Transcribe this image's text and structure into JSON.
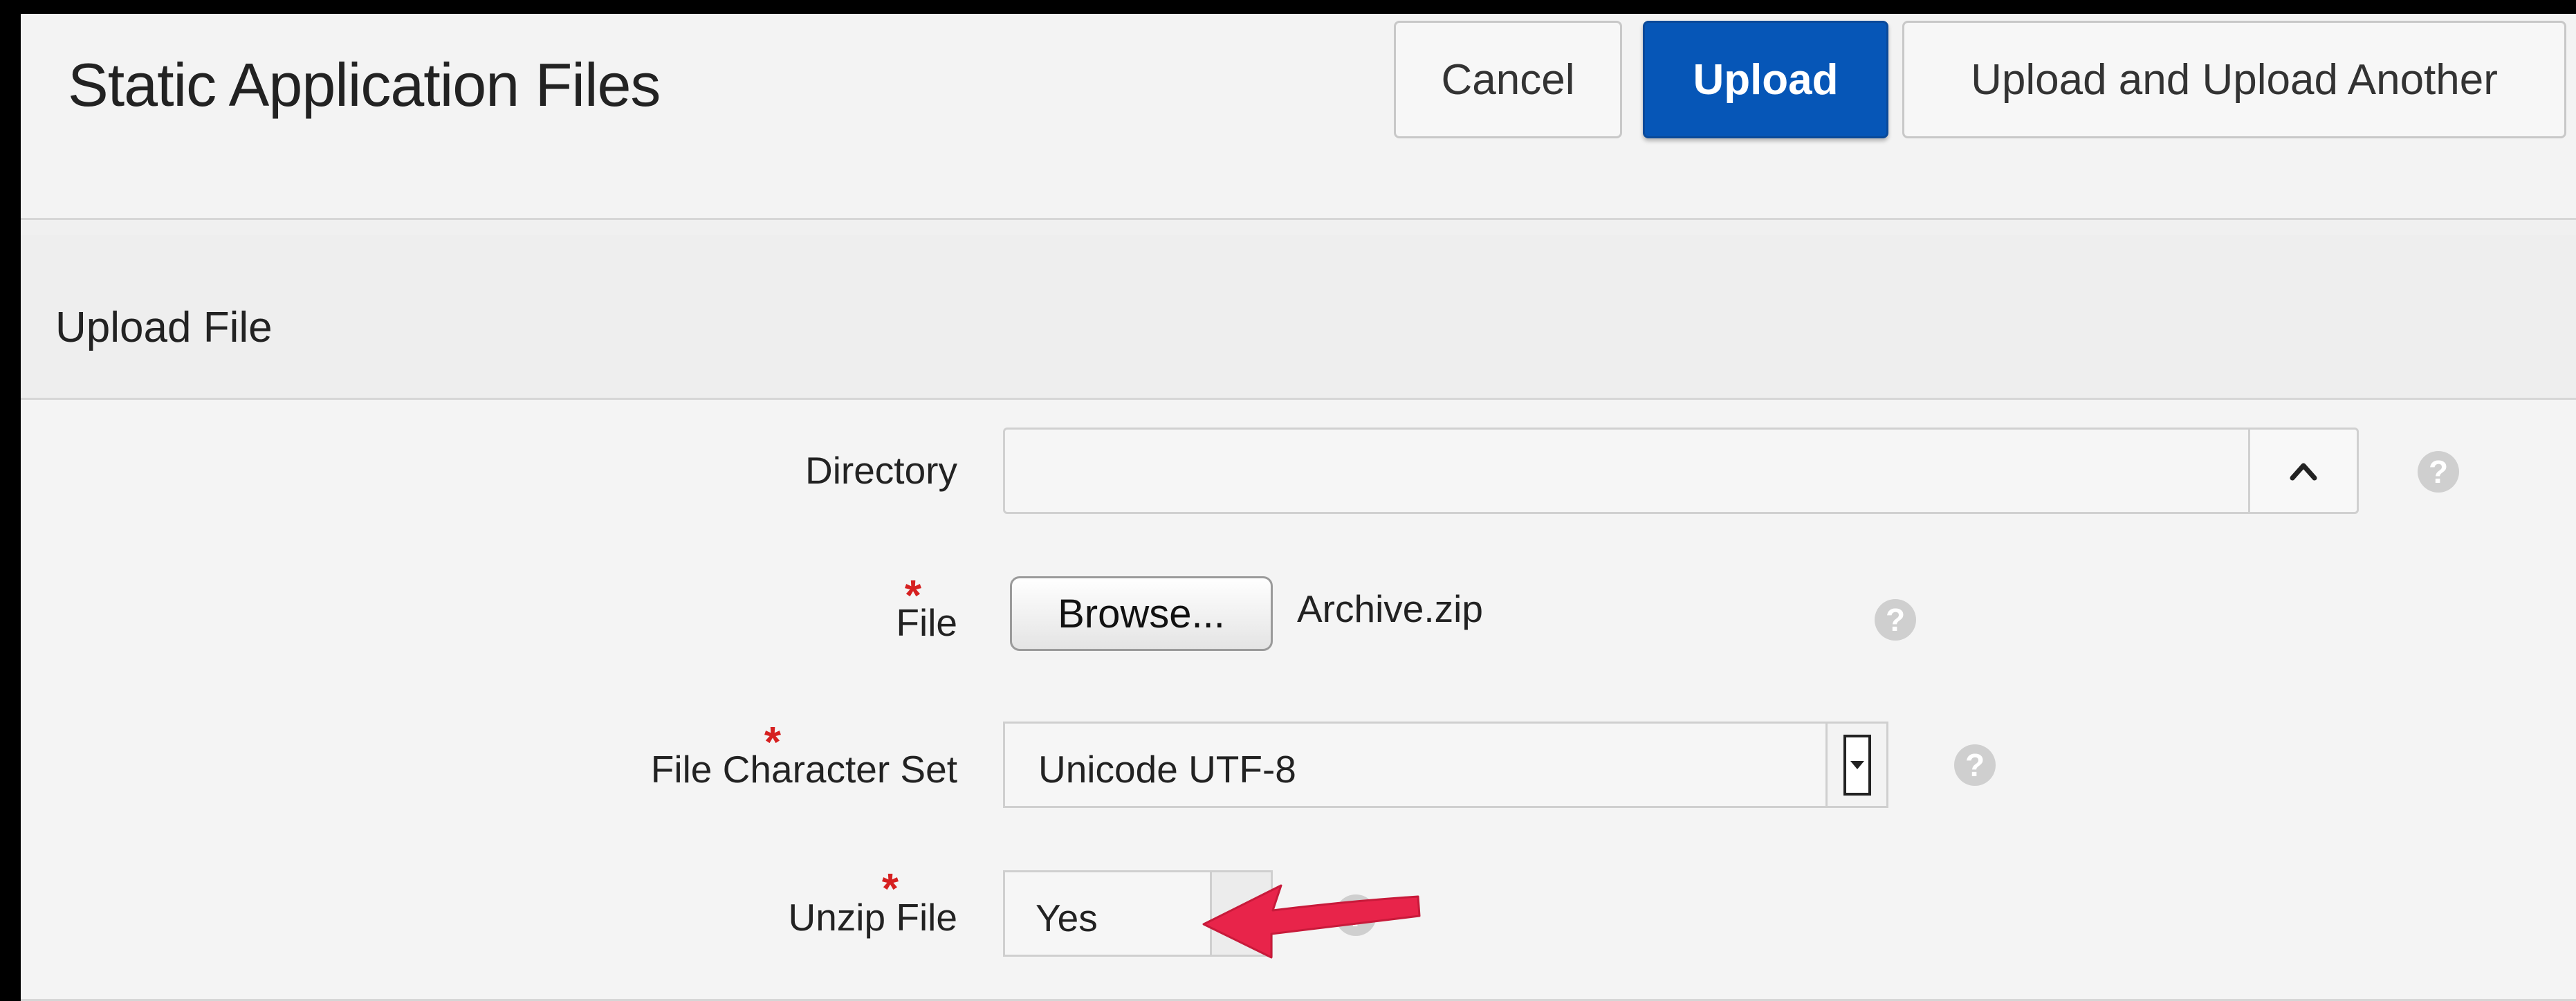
{
  "header": {
    "title": "Static Application Files",
    "buttons": {
      "cancel": "Cancel",
      "upload": "Upload",
      "upload_another": "Upload and Upload Another"
    }
  },
  "region": {
    "title": "Upload File"
  },
  "form": {
    "directory": {
      "label": "Directory",
      "value": "",
      "toggle_icon": "chevron-up-icon",
      "help_icon": "help-icon"
    },
    "file": {
      "required_mark": "*",
      "label": "File",
      "browse_label": "Browse...",
      "file_name": "Archive.zip",
      "help_icon": "help-icon"
    },
    "charset": {
      "required_mark": "*",
      "label": "File Character Set",
      "value": "Unicode UTF-8",
      "help_icon": "help-icon"
    },
    "unzip": {
      "required_mark": "*",
      "label": "Unzip File",
      "value": "Yes",
      "help_icon": "help-icon"
    }
  },
  "help_glyph": "?",
  "colors": {
    "primary_button": "#0656b7",
    "required": "#d62020",
    "annotation_arrow": "#e8244a"
  }
}
